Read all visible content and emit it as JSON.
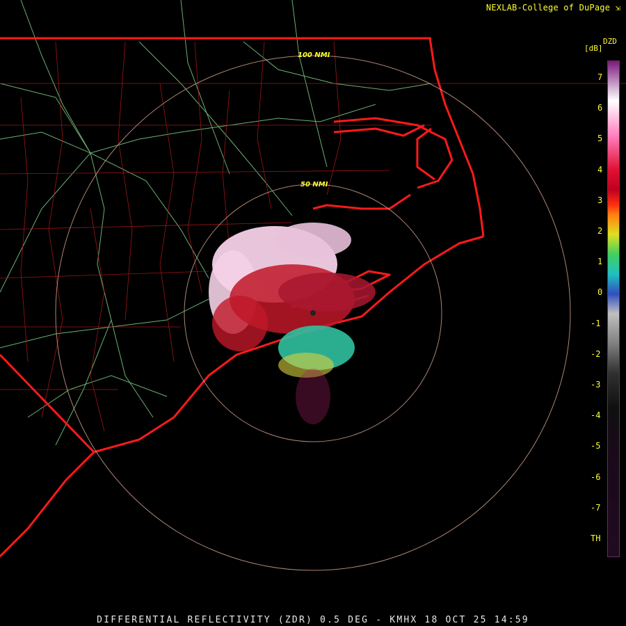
{
  "header": {
    "credit": "NEXLAB-College of DuPage",
    "credit_icon": "arrow-icon"
  },
  "footer": {
    "caption": "DIFFERENTIAL REFLECTIVITY (ZDR) 0.5 DEG - KMHX 18 OCT 25 14:59"
  },
  "rings": [
    {
      "label": "100 NMI"
    },
    {
      "label": "50 NMI"
    }
  ],
  "colorbar": {
    "product": "DZD",
    "unit": "[dB]",
    "ticks": [
      "7",
      "6",
      "5",
      "4",
      "3",
      "2",
      "1",
      "0",
      "-1",
      "-2",
      "-3",
      "-4",
      "-5",
      "-6",
      "-7",
      "TH"
    ]
  },
  "colors": {
    "background": "#000000",
    "state_borders": "#ff1a1a",
    "county_lines": "#b01818",
    "highways": "#7fd08a",
    "range_rings": "#d8a890",
    "label_text": "#ffff33",
    "echo_high": "#f4d0e6",
    "echo_mid": "#c01828",
    "echo_low": "#30c0a0"
  }
}
